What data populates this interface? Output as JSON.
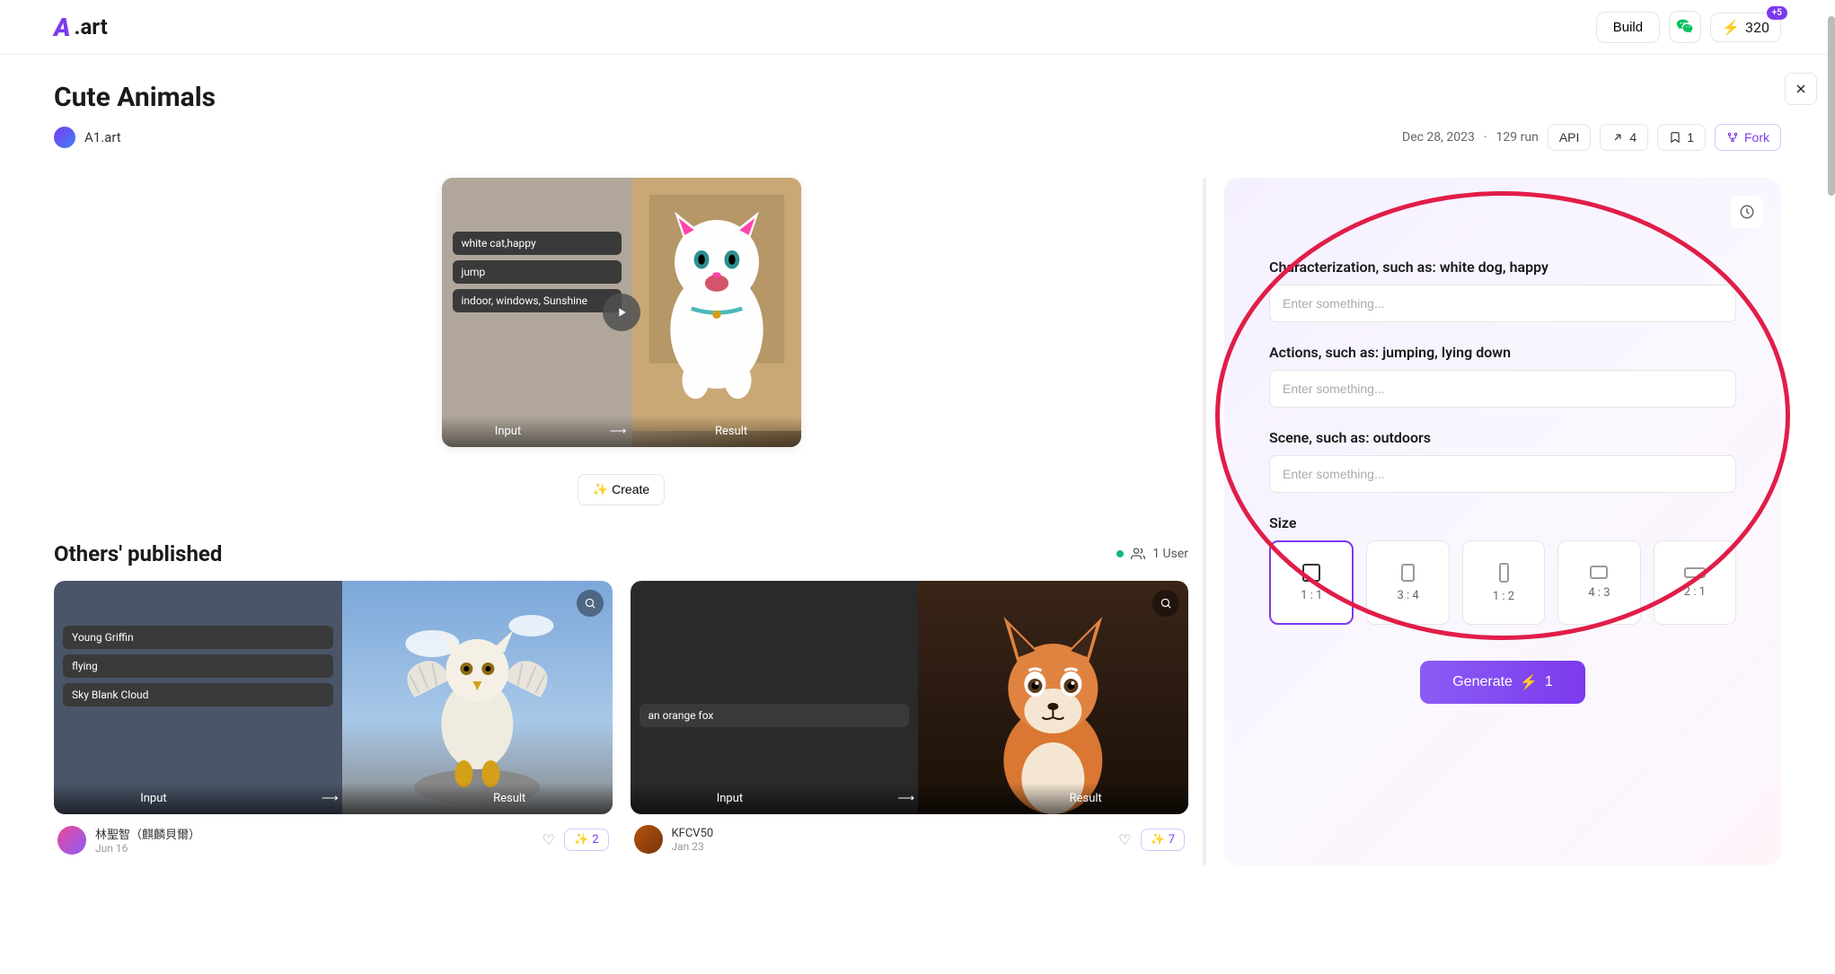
{
  "header": {
    "logo_text": ".art",
    "build": "Build",
    "credits": "320",
    "credits_badge": "+5"
  },
  "page": {
    "title": "Cute Animals",
    "author": "A1.art",
    "date": "Dec 28, 2023",
    "runs": "129 run",
    "api": "API",
    "share_count": "4",
    "bookmark_count": "1",
    "fork": "Fork"
  },
  "preview": {
    "tags": [
      "white cat,happy",
      "jump",
      "indoor, windows, Sunshine"
    ],
    "input_label": "Input",
    "result_label": "Result",
    "create": "Create"
  },
  "others": {
    "title": "Others' published",
    "user_count": "1 User",
    "cards": [
      {
        "tags": [
          "Young Griffin",
          "flying",
          "Sky Blank Cloud"
        ],
        "author": "林聖智（麒麟貝爾）",
        "date": "Jun 16",
        "count": "2",
        "input_label": "Input",
        "result_label": "Result"
      },
      {
        "tags": [
          "an orange fox"
        ],
        "author": "KFCV50",
        "date": "Jan 23",
        "count": "7",
        "input_label": "Input",
        "result_label": "Result"
      }
    ]
  },
  "form": {
    "char_label": "Characterization, such as: white dog, happy",
    "char_placeholder": "Enter something...",
    "action_label": "Actions, such as: jumping, lying down",
    "action_placeholder": "Enter something...",
    "scene_label": "Scene, such as: outdoors",
    "scene_placeholder": "Enter something...",
    "size_label": "Size",
    "sizes": [
      "1 : 1",
      "3 : 4",
      "1 : 2",
      "4 : 3",
      "2 : 1"
    ],
    "generate": "Generate",
    "generate_cost": "1"
  }
}
